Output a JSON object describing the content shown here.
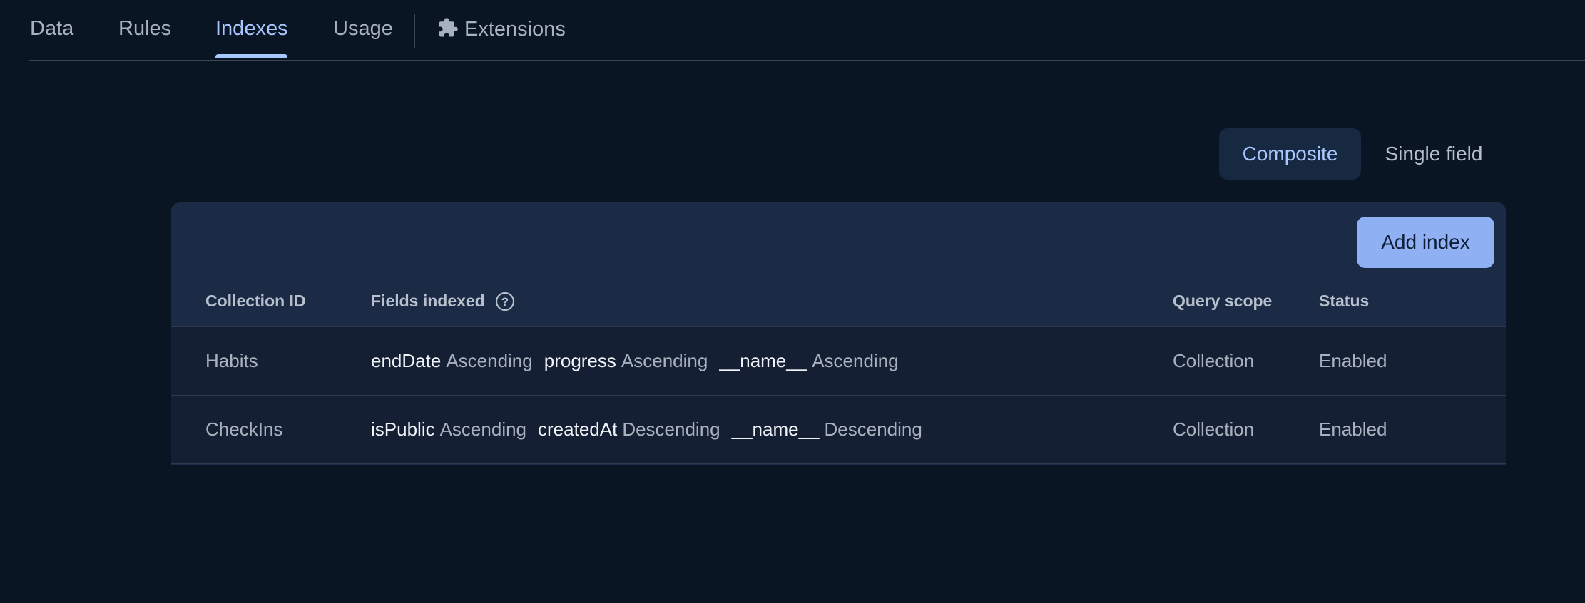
{
  "tabs": [
    {
      "label": "Data"
    },
    {
      "label": "Rules"
    },
    {
      "label": "Indexes"
    },
    {
      "label": "Usage"
    },
    {
      "label": "Extensions",
      "icon": "puzzle-icon"
    }
  ],
  "active_tab": "Indexes",
  "toggle": {
    "composite_label": "Composite",
    "single_label": "Single field",
    "selected": "Composite"
  },
  "card": {
    "add_button_label": "Add index"
  },
  "table": {
    "headers": {
      "collection_id": "Collection ID",
      "fields_indexed": "Fields indexed",
      "query_scope": "Query scope",
      "status": "Status"
    },
    "rows": [
      {
        "collection_id": "Habits",
        "fields": [
          {
            "name": "endDate",
            "order": "Ascending"
          },
          {
            "name": "progress",
            "order": "Ascending"
          },
          {
            "name": "__name__",
            "order": "Ascending"
          }
        ],
        "query_scope": "Collection",
        "status": "Enabled"
      },
      {
        "collection_id": "CheckIns",
        "fields": [
          {
            "name": "isPublic",
            "order": "Ascending"
          },
          {
            "name": "createdAt",
            "order": "Descending"
          },
          {
            "name": "__name__",
            "order": "Descending"
          }
        ],
        "query_scope": "Collection",
        "status": "Enabled"
      }
    ]
  },
  "colors": {
    "background": "#0a1524",
    "accent": "#a9c7ff",
    "button": "#8fb1f3",
    "card": "#1c2b45",
    "row": "#141f33"
  }
}
